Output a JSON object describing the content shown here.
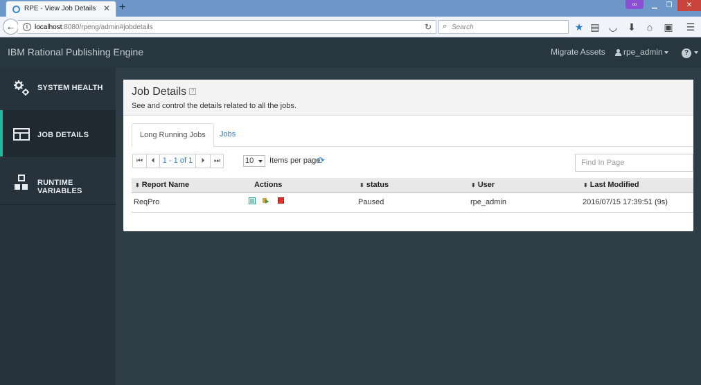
{
  "browser": {
    "tab_title": "RPE - View Job Details",
    "url_host": "localhost",
    "url_path": ":8080/rpeng/admin#jobdetails",
    "search_placeholder": "Search"
  },
  "app": {
    "title": "IBM Rational Publishing Engine",
    "migrate_link": "Migrate Assets",
    "user": "rpe_admin"
  },
  "sidebar": {
    "items": [
      {
        "label": "SYSTEM HEALTH",
        "icon": "gears-icon"
      },
      {
        "label": "JOB DETAILS",
        "icon": "table-layout-icon",
        "active": true
      },
      {
        "label": "RUNTIME VARIABLES",
        "icon": "blocks-icon"
      }
    ]
  },
  "panel": {
    "title": "Job Details",
    "subtitle": "See and control the details related to all the jobs."
  },
  "tabs": [
    "Long Running Jobs",
    "Jobs"
  ],
  "pager": {
    "info": "1 - 1 of 1",
    "per_page": "10",
    "per_page_label": "Items per page"
  },
  "find_placeholder": "Find In Page",
  "table": {
    "headers": [
      "Report Name",
      "Actions",
      "status",
      "User",
      "Last Modified"
    ],
    "rows": [
      {
        "report_name": "ReqPro",
        "status": "Paused",
        "user": "rpe_admin",
        "last_modified": "2016/07/15 17:39:51 (9s)"
      }
    ]
  },
  "colors": {
    "accent": "#1fb89e",
    "header_bg": "#283640",
    "sidebar_bg": "#26333d",
    "link": "#2a78c8"
  }
}
